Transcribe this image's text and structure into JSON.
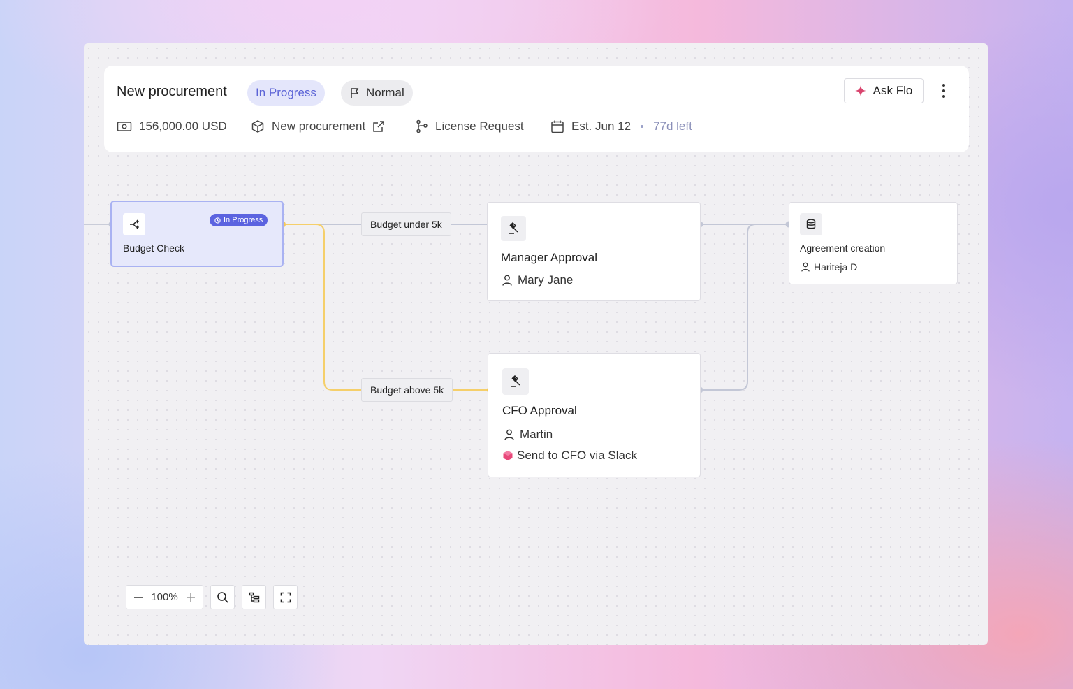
{
  "header": {
    "title": "New procurement",
    "status": "In Progress",
    "priority": "Normal",
    "ask_flo": "Ask Flo",
    "amount": "156,000.00 USD",
    "request_link": "New procurement",
    "workflow": "License Request",
    "est_date": "Est. Jun 12",
    "time_left": "77d left"
  },
  "nodes": {
    "budget_check": {
      "title": "Budget Check",
      "badge": "In Progress"
    },
    "manager_approval": {
      "title": "Manager Approval",
      "assignee": "Mary Jane"
    },
    "cfo_approval": {
      "title": "CFO Approval",
      "assignee": "Martin",
      "action": "Send to CFO via Slack"
    },
    "agreement_creation": {
      "title": "Agreement creation",
      "assignee": "Hariteja D"
    }
  },
  "edges": {
    "under": "Budget under 5k",
    "above": "Budget above 5k"
  },
  "controls": {
    "zoom_level": "100%"
  },
  "colors": {
    "accent": "#5b63e0",
    "active_path": "#f5cf6a",
    "edge": "#c3c7d6"
  }
}
